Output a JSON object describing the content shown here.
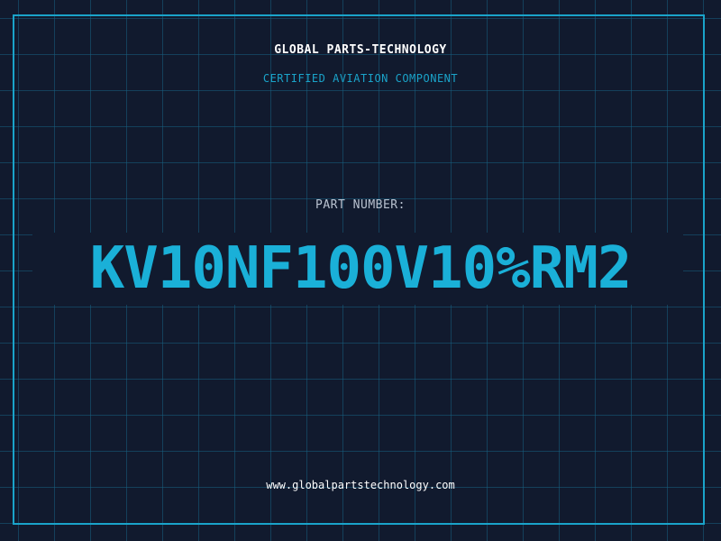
{
  "header": {
    "company": "GLOBAL PARTS-TECHNOLOGY",
    "subtitle": "CERTIFIED AVIATION COMPONENT"
  },
  "part": {
    "label": "PART NUMBER:",
    "number": "KV10NF100V10%RM2"
  },
  "footer": {
    "url": "www.globalpartstechnology.com"
  },
  "colors": {
    "background": "#111a2e",
    "grid": "#165f80",
    "accent": "#1aa3c9",
    "text": "#ffffff"
  }
}
